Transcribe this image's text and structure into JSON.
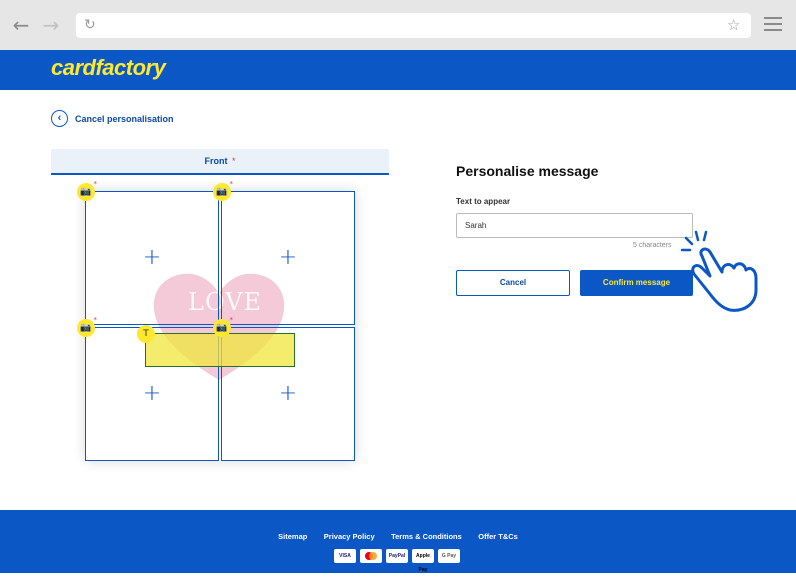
{
  "header": {
    "logo_text": "cardfactory"
  },
  "nav": {
    "cancel_label": "Cancel personalisation"
  },
  "tabs": [
    {
      "label": "Front",
      "required_mark": "*"
    }
  ],
  "card": {
    "text_overlay": "LOVE"
  },
  "form": {
    "title": "Personalise message",
    "field_label": "Text to appear",
    "field_value": "Sarah",
    "char_count": "5 characters"
  },
  "buttons": {
    "cancel": "Cancel",
    "confirm": "Confirm message"
  },
  "footer": {
    "links": [
      "Sitemap",
      "Privacy Policy",
      "Terms & Conditions",
      "Offer T&Cs"
    ],
    "payment_methods": [
      "VISA",
      "Mastercard",
      "PayPal",
      "Apple Pay",
      "G Pay"
    ]
  },
  "colors": {
    "brand_blue": "#0b57c6",
    "brand_yellow": "#ffe82e",
    "heart_pink": "#f4c9d8"
  }
}
